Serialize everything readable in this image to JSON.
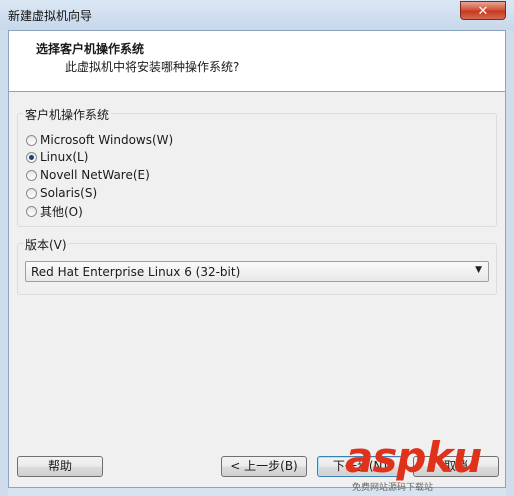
{
  "window": {
    "title": "新建虚拟机向导",
    "close_glyph": "✕"
  },
  "header": {
    "title": "选择客户机操作系统",
    "subtitle": "此虚拟机中将安装哪种操作系统?"
  },
  "os_group": {
    "label": "客户机操作系统",
    "options": [
      {
        "label": "Microsoft Windows(W)",
        "checked": false
      },
      {
        "label": "Linux(L)",
        "checked": true
      },
      {
        "label": "Novell NetWare(E)",
        "checked": false
      },
      {
        "label": "Solaris(S)",
        "checked": false
      },
      {
        "label": "其他(O)",
        "checked": false
      }
    ]
  },
  "version_group": {
    "label": "版本(V)",
    "selected": "Red Hat Enterprise Linux 6 (32-bit)"
  },
  "buttons": {
    "help": "帮助",
    "back": "< 上一步(B)",
    "next": "下一步(N)",
    "cancel": "取消"
  },
  "watermark": {
    "logo": "aspku",
    "sub": "免费网站源码下载站"
  }
}
